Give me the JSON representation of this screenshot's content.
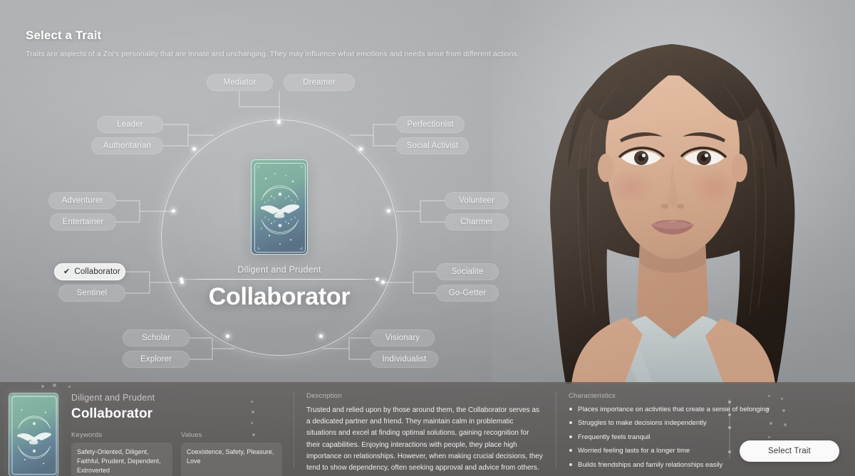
{
  "header": {
    "title": "Select a Trait",
    "subtitle": "Traits are aspects of a Zoi's personality that are innate and unchanging. They may influence what emotions and needs arise from different actions."
  },
  "center": {
    "eyebrow": "Diligent and Prudent",
    "title": "Collaborator",
    "card_icon": "handshake-tarot-card"
  },
  "colors": {
    "panel_bg": "#565250",
    "accent_button": "#fafafa",
    "node_selected_bg": "#ffffff",
    "card_top": "#7fae9f",
    "card_bottom": "#5b7285"
  },
  "trait_web": {
    "groups": [
      {
        "position": "top",
        "items": [
          {
            "label": "Mediator",
            "selected": false
          },
          {
            "label": "Dreamer",
            "selected": false
          }
        ]
      },
      {
        "position": "upper-left",
        "items": [
          {
            "label": "Leader",
            "selected": false
          },
          {
            "label": "Authoritarian",
            "selected": false
          }
        ]
      },
      {
        "position": "left",
        "items": [
          {
            "label": "Adventurer",
            "selected": false
          },
          {
            "label": "Entertainer",
            "selected": false
          }
        ]
      },
      {
        "position": "lower-left",
        "items": [
          {
            "label": "Collaborator",
            "selected": true
          },
          {
            "label": "Sentinel",
            "selected": false
          }
        ]
      },
      {
        "position": "bottom-left",
        "items": [
          {
            "label": "Scholar",
            "selected": false
          },
          {
            "label": "Explorer",
            "selected": false
          }
        ]
      },
      {
        "position": "upper-right",
        "items": [
          {
            "label": "Perfectionist",
            "selected": false
          },
          {
            "label": "Social Activist",
            "selected": false
          }
        ]
      },
      {
        "position": "right",
        "items": [
          {
            "label": "Volunteer",
            "selected": false
          },
          {
            "label": "Charmer",
            "selected": false
          }
        ]
      },
      {
        "position": "lower-right",
        "items": [
          {
            "label": "Socialite",
            "selected": false
          },
          {
            "label": "Go-Getter",
            "selected": false
          }
        ]
      },
      {
        "position": "bottom-right",
        "items": [
          {
            "label": "Visionary",
            "selected": false
          },
          {
            "label": "Individualist",
            "selected": false
          }
        ]
      }
    ],
    "nodes": {
      "mediator": "Mediator",
      "dreamer": "Dreamer",
      "leader": "Leader",
      "authoritarian": "Authoritarian",
      "adventurer": "Adventurer",
      "entertainer": "Entertainer",
      "collaborator": "Collaborator",
      "sentinel": "Sentinel",
      "scholar": "Scholar",
      "explorer": "Explorer",
      "perfectionist": "Perfectionist",
      "social_activist": "Social Activist",
      "volunteer": "Volunteer",
      "charmer": "Charmer",
      "socialite": "Socialite",
      "go_getter": "Go-Getter",
      "visionary": "Visionary",
      "individualist": "Individualist"
    },
    "selected_check": "✔"
  },
  "detail": {
    "eyebrow": "Diligent and Prudent",
    "name": "Collaborator",
    "keywords_label": "Keywords",
    "keywords_value": "Safety-Oriented, Diligent, Faithful, Prudent, Dependent, Extroverted",
    "values_label": "Values",
    "values_value": "Coexistence, Safety, Pleasure, Love",
    "description_label": "Description",
    "description": "Trusted and relied upon by those around them, the Collaborator serves as a dedicated partner and friend. They maintain calm in problematic situations and excel at finding optimal solutions, gaining recognition for their capabilities. Enjoying interactions with people, they place high importance on relationships. However, when making crucial decisions, they tend to show dependency, often seeking approval and advice from others. They",
    "characteristics_label": "Characteristics",
    "characteristics": [
      "Places importance on activities that create a sense of belonging",
      "Struggles to make decisions independently",
      "Frequently feels tranquil",
      "Worried feeling lasts for a longer time",
      "Builds friendships and family relationships easily"
    ]
  },
  "actions": {
    "select_trait": "Select Trait"
  }
}
